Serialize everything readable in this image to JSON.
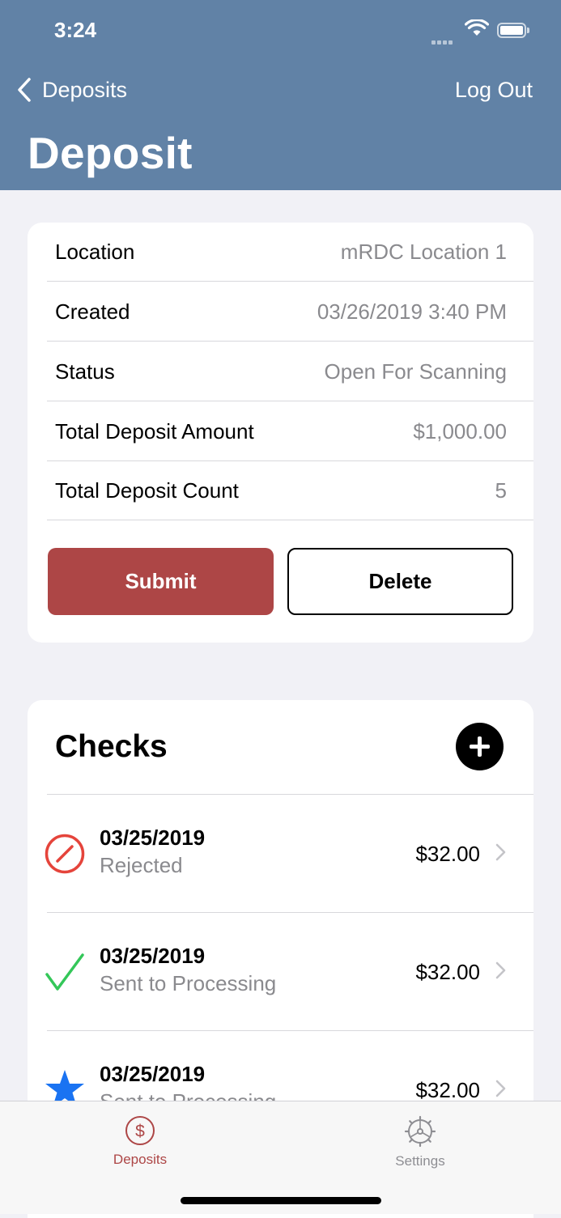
{
  "status_bar": {
    "time": "3:24"
  },
  "nav": {
    "back_label": "Deposits",
    "logout_label": "Log Out",
    "title": "Deposit"
  },
  "details": [
    {
      "label": "Location",
      "value": "mRDC Location 1"
    },
    {
      "label": "Created",
      "value": "03/26/2019 3:40 PM"
    },
    {
      "label": "Status",
      "value": "Open For Scanning"
    },
    {
      "label": "Total Deposit Amount",
      "value": "$1,000.00"
    },
    {
      "label": "Total Deposit Count",
      "value": "5"
    }
  ],
  "actions": {
    "submit_label": "Submit",
    "delete_label": "Delete"
  },
  "checks": {
    "title": "Checks",
    "items": [
      {
        "date": "03/25/2019",
        "status": "Rejected",
        "amount": "$32.00",
        "icon": "rejected-icon"
      },
      {
        "date": "03/25/2019",
        "status": "Sent to Processing",
        "amount": "$32.00",
        "icon": "checkmark-icon"
      },
      {
        "date": "03/25/2019",
        "status": "Sent to Processing",
        "amount": "$32.00",
        "icon": "star-icon"
      }
    ]
  },
  "tabbar": {
    "deposits_label": "Deposits",
    "settings_label": "Settings"
  },
  "colors": {
    "header": "#6182a6",
    "accent": "#ad4646",
    "rejected": "#e5443b",
    "success": "#34c759",
    "star": "#1a73f2"
  }
}
